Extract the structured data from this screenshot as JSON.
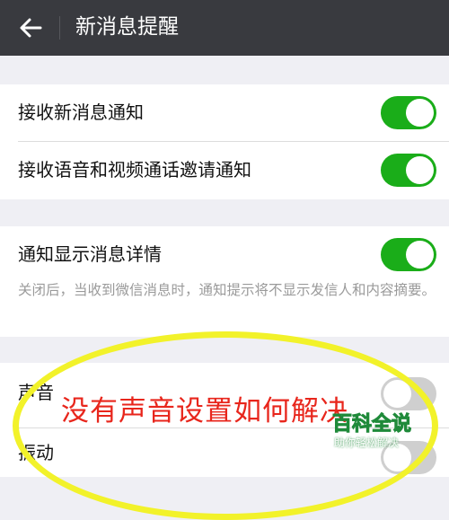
{
  "header": {
    "title": "新消息提醒",
    "back_icon": "arrow-left-icon"
  },
  "sections": {
    "notify": {
      "receive_new": {
        "label": "接收新消息通知",
        "enabled": true
      },
      "receive_call": {
        "label": "接收语音和视频通话邀请通知",
        "enabled": true
      }
    },
    "detail": {
      "label": "通知显示消息详情",
      "enabled": true,
      "description": "关闭后，当收到微信消息时，通知提示将不显示发信人和内容摘要。"
    },
    "alert": {
      "sound": {
        "label": "声音",
        "enabled": false
      },
      "vibrate": {
        "label": "振动",
        "enabled": false
      }
    }
  },
  "overlay": {
    "question": "没有声音设置如何解决",
    "watermark_title": "百科全说",
    "watermark_subtitle": "助你轻松解决"
  },
  "colors": {
    "titlebar": "#393a3f",
    "toggle_on": "#1aad19",
    "toggle_off": "#cfcfcf",
    "background": "#efeff4",
    "overlay_ring": "#f2f22a",
    "overlay_text": "#e8261c"
  }
}
